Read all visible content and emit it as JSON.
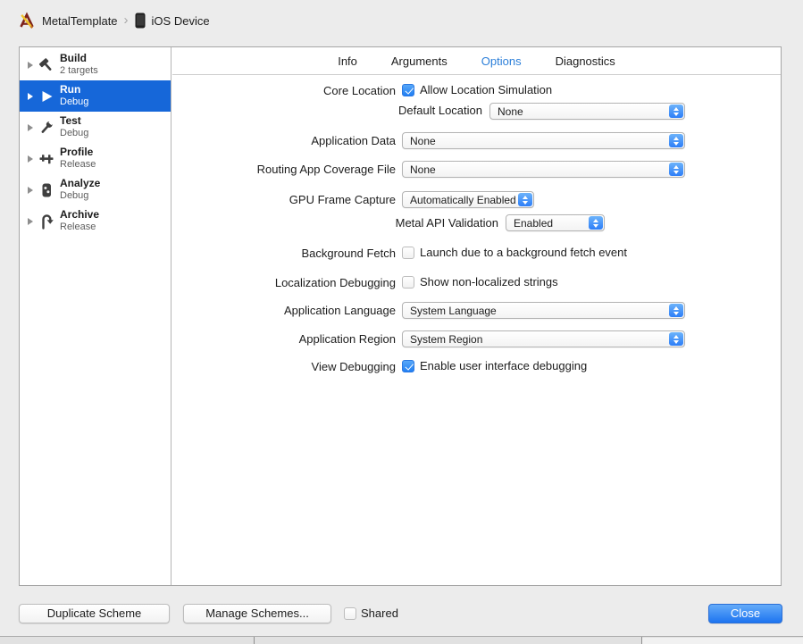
{
  "breadcrumb": {
    "scheme": "MetalTemplate",
    "separator": "›",
    "destination": "iOS Device"
  },
  "sidebar": {
    "items": [
      {
        "label": "Build",
        "sublabel": "2 targets",
        "icon": "hammer-icon",
        "selected": false
      },
      {
        "label": "Run",
        "sublabel": "Debug",
        "icon": "play-icon",
        "selected": true
      },
      {
        "label": "Test",
        "sublabel": "Debug",
        "icon": "wrench-icon",
        "selected": false
      },
      {
        "label": "Profile",
        "sublabel": "Release",
        "icon": "caliper-icon",
        "selected": false
      },
      {
        "label": "Analyze",
        "sublabel": "Debug",
        "icon": "meter-icon",
        "selected": false
      },
      {
        "label": "Archive",
        "sublabel": "Release",
        "icon": "archive-icon",
        "selected": false
      }
    ]
  },
  "tabs": [
    {
      "label": "Info",
      "selected": false
    },
    {
      "label": "Arguments",
      "selected": false
    },
    {
      "label": "Options",
      "selected": true
    },
    {
      "label": "Diagnostics",
      "selected": false
    }
  ],
  "form": {
    "core_location": {
      "label": "Core Location",
      "checkbox_label": "Allow Location Simulation",
      "checked": true
    },
    "default_location": {
      "label": "Default Location",
      "value": "None"
    },
    "application_data": {
      "label": "Application Data",
      "value": "None"
    },
    "routing_app_coverage": {
      "label": "Routing App Coverage File",
      "value": "None"
    },
    "gpu_frame_capture": {
      "label": "GPU Frame Capture",
      "value": "Automatically Enabled"
    },
    "metal_api_validation": {
      "label": "Metal API Validation",
      "value": "Enabled"
    },
    "background_fetch": {
      "label": "Background Fetch",
      "checkbox_label": "Launch due to a background fetch event",
      "checked": false
    },
    "localization_debugging": {
      "label": "Localization Debugging",
      "checkbox_label": "Show non-localized strings",
      "checked": false
    },
    "application_language": {
      "label": "Application Language",
      "value": "System Language"
    },
    "application_region": {
      "label": "Application Region",
      "value": "System Region"
    },
    "view_debugging": {
      "label": "View Debugging",
      "checkbox_label": "Enable user interface debugging",
      "checked": true
    }
  },
  "footer": {
    "duplicate_label": "Duplicate Scheme",
    "manage_label": "Manage Schemes...",
    "shared_label": "Shared",
    "shared_checked": false,
    "close_label": "Close"
  },
  "colors": {
    "selection_blue": "#1667d9",
    "accent_blue": "#2d7ef8",
    "tab_active_blue": "#2c7fd9",
    "window_gray": "#ececec"
  }
}
